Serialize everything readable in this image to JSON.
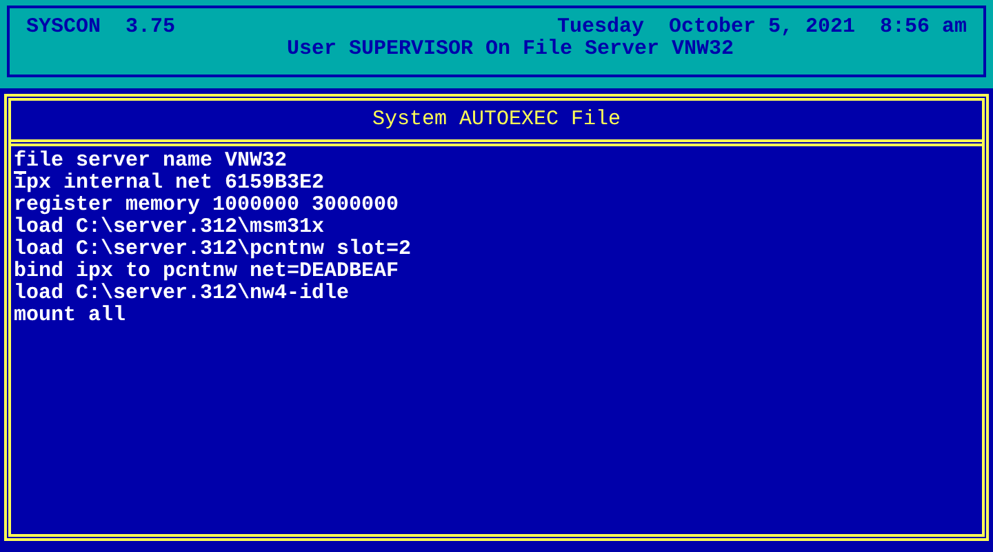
{
  "header": {
    "app_name": "SYSCON  3.75",
    "datetime": "Tuesday  October 5, 2021  8:56 am",
    "user_line": "User SUPERVISOR On File Server VNW32"
  },
  "editor": {
    "title": "System AUTOEXEC File",
    "lines": [
      "file server name VNW32",
      "ipx internal net 6159B3E2",
      "register memory 1000000 3000000",
      "load C:\\server.312\\msm31x",
      "load C:\\server.312\\pcntnw slot=2",
      "bind ipx to pcntnw net=DEADBEAF",
      "load C:\\server.312\\nw4-idle",
      "mount all"
    ]
  }
}
